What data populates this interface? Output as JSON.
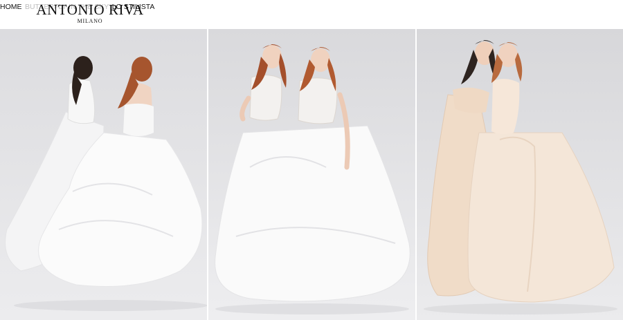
{
  "brand": {
    "name": "ANTONIO RIVA",
    "city": "MILANO"
  },
  "nav": {
    "items": [
      {
        "label": "HOME",
        "state": "active"
      },
      {
        "label": "BUTTERFLY IN THE SKY",
        "state": "muted"
      },
      {
        "label": "LO STILISTA",
        "state": "normal"
      }
    ]
  },
  "colors": {
    "header_bg": "#ffffff",
    "nav_text": "#111111",
    "nav_muted": "#bdbdbd",
    "backdrop": "#e2e2e4",
    "gown_white": "#fbfbfb",
    "gown_champagne": "#f3e2d2"
  },
  "gallery": {
    "panels": [
      {
        "subject": "two brides in white layered ball gowns, back view"
      },
      {
        "subject": "two brides in white lace-bodice ball gowns, front view"
      },
      {
        "subject": "two brides in champagne satin gowns"
      }
    ]
  }
}
